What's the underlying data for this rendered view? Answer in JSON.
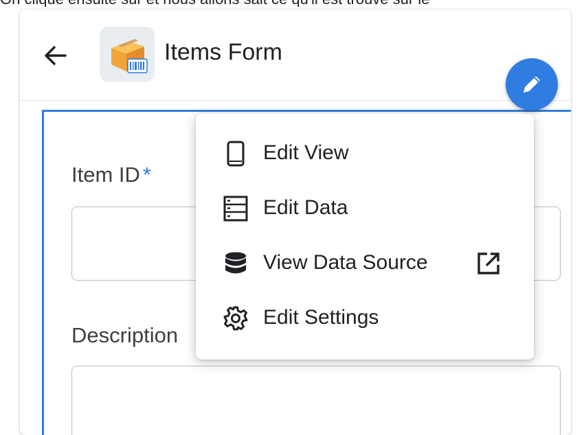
{
  "caption": "On clique ensuite sur    et nous allons sait ce qu'il est trouvé sur le",
  "header": {
    "title": "Items Form",
    "back_icon": "arrow-left-icon",
    "app_icon": "package-barcode-icon"
  },
  "fab": {
    "icon": "pencil-icon",
    "color": "#2f7de1"
  },
  "form": {
    "fields": [
      {
        "label": "Item ID",
        "required_mark": "*",
        "value": ""
      },
      {
        "label": "Description",
        "value": ""
      }
    ]
  },
  "menu": {
    "items": [
      {
        "label": "Edit View",
        "icon": "mobile-phone-icon"
      },
      {
        "label": "Edit Data",
        "icon": "table-rows-icon"
      },
      {
        "label": "View Data Source",
        "icon": "database-icon",
        "trailing_icon": "external-link-icon"
      },
      {
        "label": "Edit Settings",
        "icon": "gear-icon"
      }
    ]
  },
  "colors": {
    "accent": "#2f7de1",
    "text": "#202124"
  }
}
